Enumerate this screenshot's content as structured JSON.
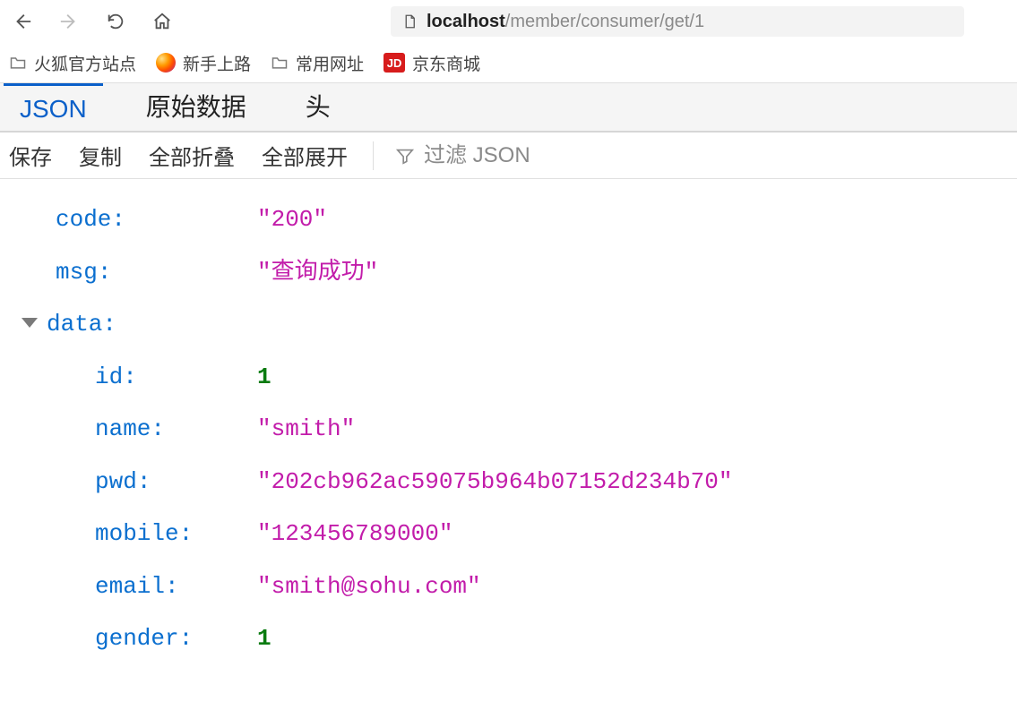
{
  "url": {
    "host": "localhost",
    "rest": "/member/consumer/get/1"
  },
  "bookmarks": {
    "b1": "火狐官方站点",
    "b2": "新手上路",
    "b3": "常用网址",
    "b4": "京东商城",
    "jd": "JD"
  },
  "tabs": {
    "json": "JSON",
    "raw": "原始数据",
    "headers": "头"
  },
  "actions": {
    "save": "保存",
    "copy": "复制",
    "collapse": "全部折叠",
    "expand": "全部展开",
    "filter_placeholder": "过滤 JSON"
  },
  "json": {
    "k_code": "code",
    "v_code": "\"200\"",
    "k_msg": "msg",
    "v_msg": "\"查询成功\"",
    "k_data": "data",
    "k_id": "id",
    "v_id": "1",
    "k_name": "name",
    "v_name": "\"smith\"",
    "k_pwd": "pwd",
    "v_pwd": "\"202cb962ac59075b964b07152d234b70\"",
    "k_mobile": "mobile",
    "v_mobile": "\"123456789000\"",
    "k_email": "email",
    "v_email": "\"smith@sohu.com\"",
    "k_gender": "gender",
    "v_gender": "1"
  }
}
